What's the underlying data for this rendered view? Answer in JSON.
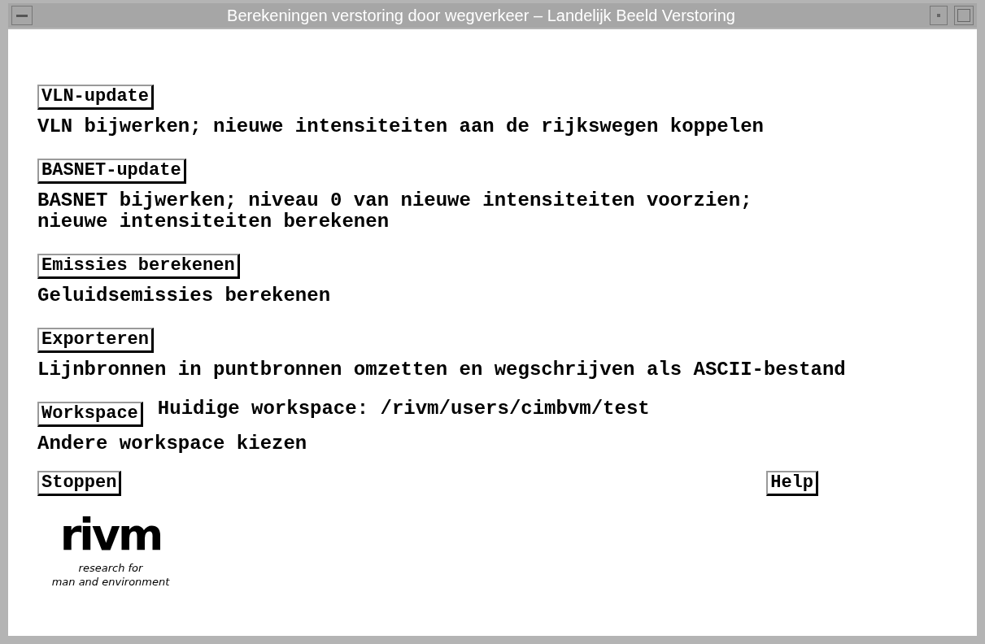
{
  "window": {
    "title": "Berekeningen verstoring door wegverkeer – Landelijk Beeld Verstoring"
  },
  "sections": [
    {
      "button": "VLN-update",
      "lines": [
        "VLN bijwerken; nieuwe intensiteiten aan de rijkswegen koppelen"
      ]
    },
    {
      "button": "BASNET-update",
      "lines": [
        "BASNET bijwerken; niveau 0 van nieuwe intensiteiten voorzien;",
        "nieuwe intensiteiten berekenen"
      ]
    },
    {
      "button": "Emissies berekenen",
      "lines": [
        "Geluidsemissies berekenen"
      ]
    },
    {
      "button": "Exporteren",
      "lines": [
        "Lijnbronnen in puntbronnen omzetten en wegschrijven als ASCII-bestand"
      ]
    },
    {
      "button": "Workspace",
      "status": "Huidige workspace: /rivm/users/cimbvm/test",
      "lines": [
        "Andere workspace kiezen"
      ]
    }
  ],
  "footer": {
    "left_button": "Stoppen",
    "right_button": "Help"
  },
  "logo": {
    "wordmark": "rivm",
    "tagline": [
      "research for",
      "man and environment"
    ]
  }
}
